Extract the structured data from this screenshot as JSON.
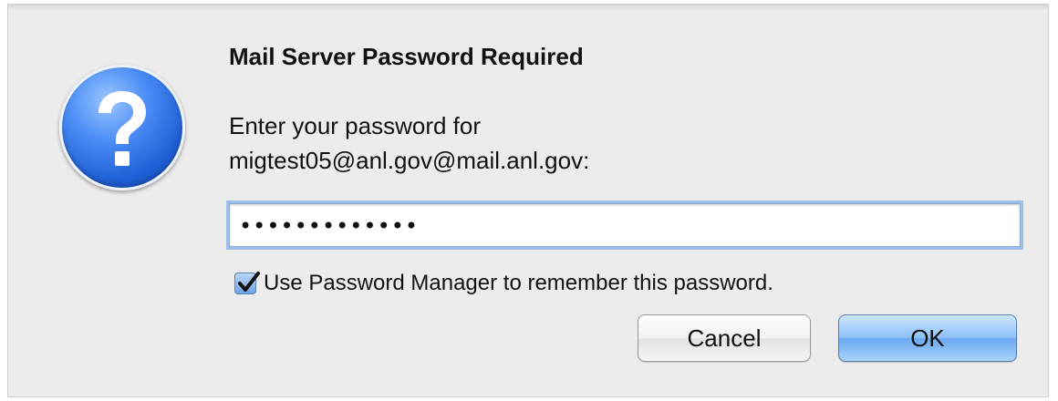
{
  "dialog": {
    "title": "Mail Server Password Required",
    "message_line1": "Enter your password for",
    "message_line2": "migtest05@anl.gov@mail.anl.gov:",
    "icon": "question-icon",
    "password_value": "•••••••••••••",
    "remember": {
      "checked": true,
      "label": "Use Password Manager to remember this password."
    },
    "buttons": {
      "cancel_label": "Cancel",
      "ok_label": "OK"
    }
  },
  "colors": {
    "background": "#ececec",
    "icon_blue": "#2f6fe0",
    "focus_ring": "#9fc0ea",
    "default_button": "#8cc0f7"
  }
}
